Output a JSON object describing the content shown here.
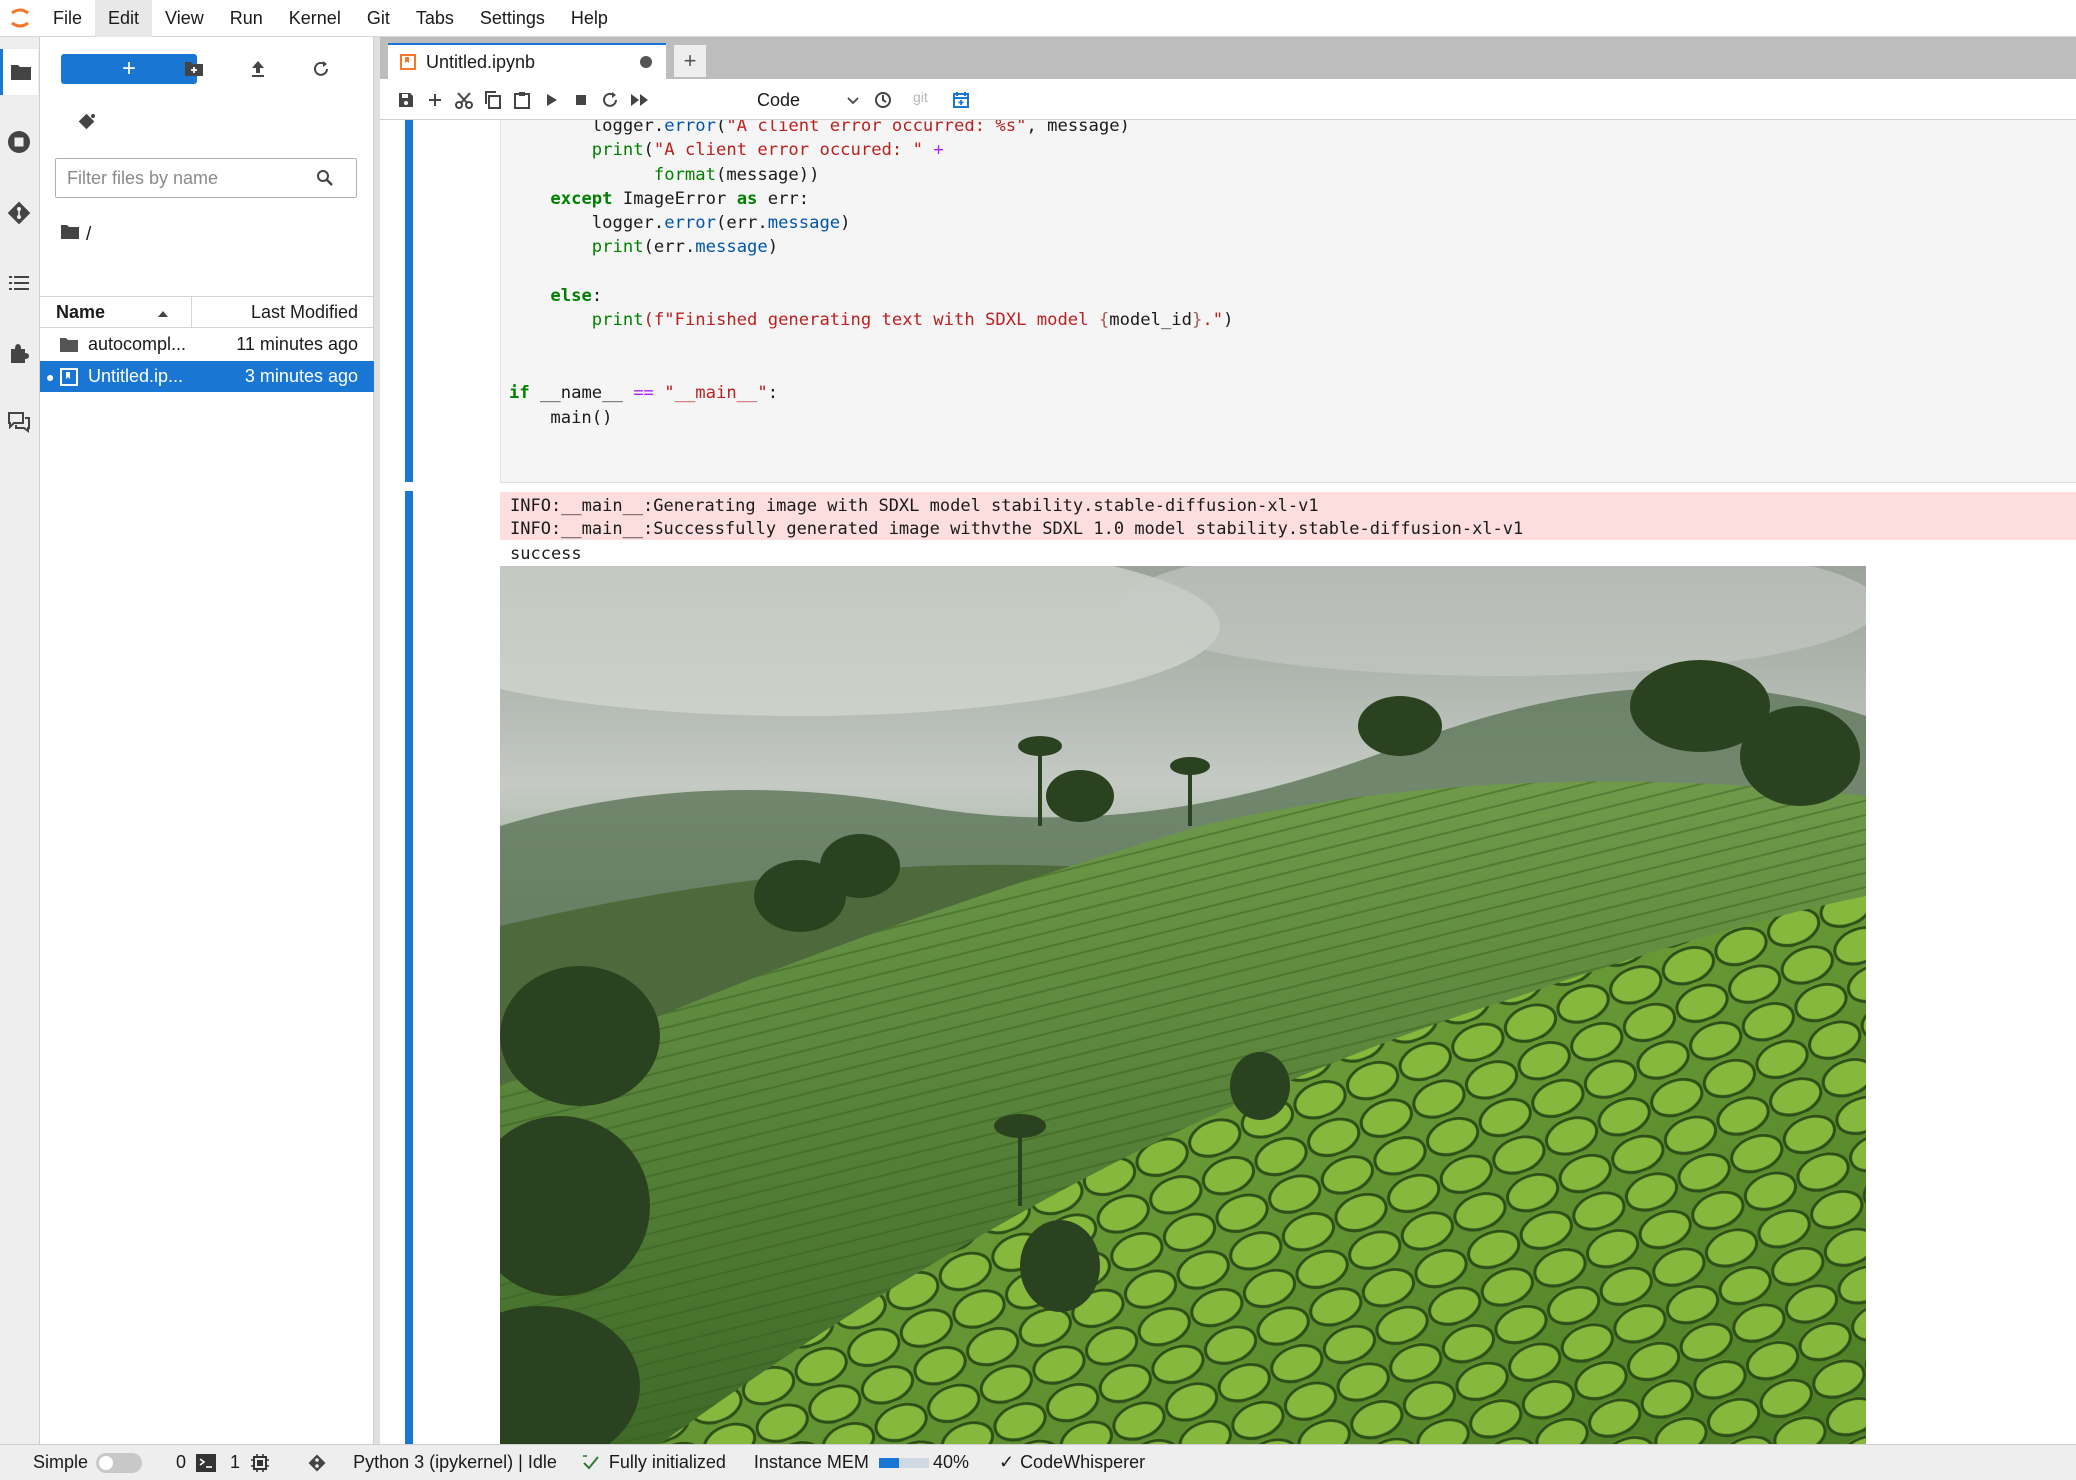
{
  "menubar": {
    "items": [
      "File",
      "Edit",
      "View",
      "Run",
      "Kernel",
      "Git",
      "Tabs",
      "Settings",
      "Help"
    ],
    "active_index": 1
  },
  "file_browser": {
    "new_button_label": "+",
    "filter_placeholder": "Filter files by name",
    "breadcrumb": "/",
    "columns": {
      "name": "Name",
      "modified": "Last Modified"
    },
    "rows": [
      {
        "name": "autocompl...",
        "modified": "11 minutes ago",
        "type": "folder",
        "selected": false
      },
      {
        "name": "Untitled.ip...",
        "modified": "3 minutes ago",
        "type": "notebook",
        "selected": true
      }
    ]
  },
  "tabs": [
    {
      "label": "Untitled.ipynb",
      "dirty": true
    }
  ],
  "new_tab_label": "+",
  "toolbar": {
    "cell_type": "Code",
    "git_label": "git"
  },
  "code_lines": [
    [
      [
        "        logger.",
        ""
      ],
      [
        "error",
        "fn"
      ],
      [
        "(",
        ""
      ],
      [
        "\"A client error occurred: %s\"",
        "str"
      ],
      [
        ", message)",
        ""
      ]
    ],
    [
      [
        "        ",
        ""
      ],
      [
        "print",
        "fn2"
      ],
      [
        "(",
        ""
      ],
      [
        "\"A client error occured: \"",
        "str"
      ],
      [
        " ",
        ""
      ],
      [
        "+",
        "op"
      ]
    ],
    [
      [
        "              ",
        ""
      ],
      [
        "format",
        "fn2"
      ],
      [
        "(message))",
        ""
      ]
    ],
    [
      [
        "    ",
        ""
      ],
      [
        "except",
        "kw"
      ],
      [
        " ImageError ",
        ""
      ],
      [
        "as",
        "kw"
      ],
      [
        " err:",
        ""
      ]
    ],
    [
      [
        "        logger.",
        ""
      ],
      [
        "error",
        "fn"
      ],
      [
        "(err.",
        ""
      ],
      [
        "message",
        "fn"
      ],
      [
        ")",
        ""
      ]
    ],
    [
      [
        "        ",
        ""
      ],
      [
        "print",
        "fn2"
      ],
      [
        "(err.",
        ""
      ],
      [
        "message",
        "fn"
      ],
      [
        ")",
        ""
      ]
    ],
    [
      [
        "",
        ""
      ]
    ],
    [
      [
        "    ",
        ""
      ],
      [
        "else",
        "kw"
      ],
      [
        ":",
        ""
      ]
    ],
    [
      [
        "        ",
        ""
      ],
      [
        "print",
        "fn2"
      ],
      [
        "(f\"Finished generating text with SDXL model ",
        "str"
      ],
      [
        "{",
        "fs"
      ],
      [
        "model_id",
        ""
      ],
      [
        "}",
        "fs"
      ],
      [
        ".\"",
        "str"
      ],
      [
        ")",
        ""
      ]
    ],
    [
      [
        "",
        ""
      ]
    ],
    [
      [
        "",
        ""
      ]
    ],
    [
      [
        "",
        ""
      ],
      [
        "if",
        "kw"
      ],
      [
        " __name__ ",
        ""
      ],
      [
        "==",
        "op"
      ],
      [
        " ",
        ""
      ],
      [
        "\"__main__\"",
        "str"
      ],
      [
        ":",
        ""
      ]
    ],
    [
      [
        "    main()",
        ""
      ]
    ]
  ],
  "output": {
    "stderr": "INFO:__main__:Generating image with SDXL model stability.stable-diffusion-xl-v1\nINFO:__main__:Successfully generated image withvthe SDXL 1.0 model stability.stable-diffusion-xl-v1",
    "stdout": "success",
    "image_subject": "misty hillside tea plantation with palm trees"
  },
  "statusbar": {
    "simple_label": "Simple",
    "terminals_count": "0",
    "kernels_count": "1",
    "kernel_status": "Python 3 (ipykernel) | Idle",
    "lsp_status": "Fully initialized",
    "mem_label": "Instance MEM",
    "mem_percent": 40,
    "mem_percent_text": "40%",
    "codewhisperer": "CodeWhisperer"
  },
  "colors": {
    "accent": "#1976d2",
    "stderr_bg": "#fcdede",
    "code_bg": "#f5f5f5"
  }
}
